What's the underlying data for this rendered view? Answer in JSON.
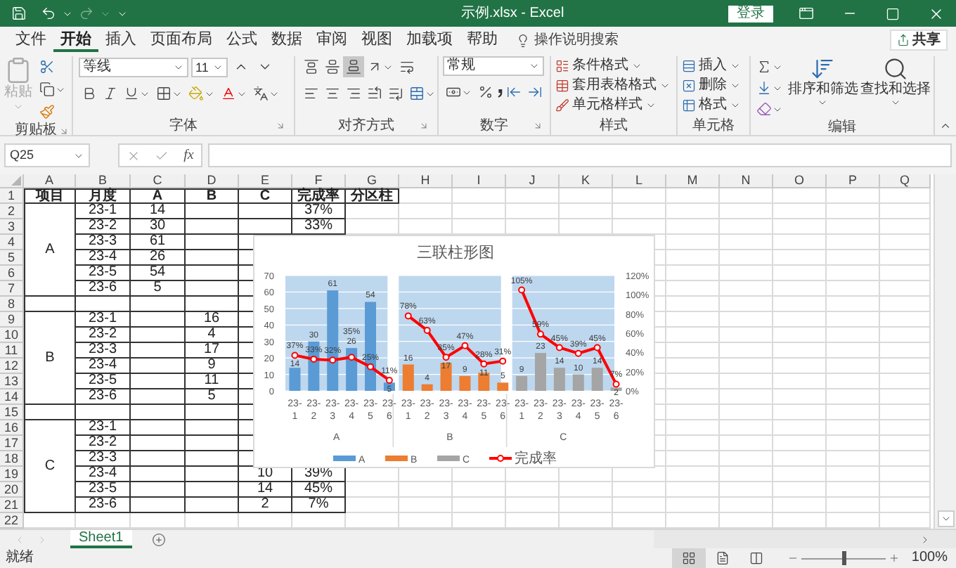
{
  "title_bar": {
    "title": "示例.xlsx - Excel",
    "sign_in": "登录",
    "redo_disabled": true
  },
  "ribbon_tabs": [
    {
      "label": "文件",
      "selected": false
    },
    {
      "label": "开始",
      "selected": true
    },
    {
      "label": "插入",
      "selected": false
    },
    {
      "label": "页面布局",
      "selected": false
    },
    {
      "label": "公式",
      "selected": false
    },
    {
      "label": "数据",
      "selected": false
    },
    {
      "label": "审阅",
      "selected": false
    },
    {
      "label": "视图",
      "selected": false
    },
    {
      "label": "加载项",
      "selected": false
    },
    {
      "label": "帮助",
      "selected": false
    }
  ],
  "tell_me": "操作说明搜索",
  "share": "共享",
  "ribbon": {
    "clipboard": {
      "paste": "粘贴",
      "paste_disabled": true,
      "label": "剪贴板"
    },
    "font": {
      "font_name": "等线",
      "font_size": "11",
      "label": "字体"
    },
    "alignment": {
      "vertical": [
        {
          "kind": "top",
          "selected": false
        },
        {
          "kind": "middle",
          "selected": false
        },
        {
          "kind": "bottom",
          "selected": true
        }
      ],
      "label": "对齐方式"
    },
    "number": {
      "format": "常规",
      "label": "数字"
    },
    "styles": {
      "items": [
        "条件格式",
        "套用表格格式",
        "单元格样式"
      ],
      "label": "样式"
    },
    "cells": {
      "items": [
        "插入",
        "删除",
        "格式"
      ],
      "label": "单元格"
    },
    "editing": {
      "sort": "排序和筛选",
      "find": "查找和选择",
      "label": "编辑"
    }
  },
  "formula_bar": {
    "name_box": "Q25",
    "function_label": "fx"
  },
  "sheet": {
    "columns": [
      "A",
      "B",
      "C",
      "D",
      "E",
      "F",
      "G",
      "H",
      "I",
      "J",
      "K",
      "L",
      "M",
      "N",
      "O",
      "P",
      "Q"
    ],
    "row_numbers": [
      "1",
      "2",
      "3",
      "4",
      "5",
      "6",
      "7",
      "8",
      "9",
      "10",
      "11",
      "12",
      "13",
      "14",
      "15",
      "16",
      "17",
      "18",
      "19",
      "20",
      "21",
      "22"
    ],
    "header_row": [
      "项目",
      "月度",
      "A",
      "B",
      "C",
      "完成率",
      "分区柱"
    ],
    "groups": [
      {
        "item": "A",
        "rows": [
          {
            "month": "23-1",
            "a": "14",
            "rate": "37%"
          },
          {
            "month": "23-2",
            "a": "30",
            "rate": "33%"
          },
          {
            "month": "23-3",
            "a": "61"
          },
          {
            "month": "23-4",
            "a": "26"
          },
          {
            "month": "23-5",
            "a": "54"
          },
          {
            "month": "23-6",
            "a": "5"
          }
        ]
      },
      {
        "item": "B",
        "rows": [
          {
            "month": "23-1",
            "b": "16"
          },
          {
            "month": "23-2",
            "b": "4"
          },
          {
            "month": "23-3",
            "b": "17"
          },
          {
            "month": "23-4",
            "b": "9"
          },
          {
            "month": "23-5",
            "b": "11"
          },
          {
            "month": "23-6",
            "b": "5"
          }
        ]
      },
      {
        "item": "C",
        "rows": [
          {
            "month": "23-1"
          },
          {
            "month": "23-2"
          },
          {
            "month": "23-3"
          },
          {
            "month": "23-4",
            "c": "10",
            "rate": "39%"
          },
          {
            "month": "23-5",
            "c": "14",
            "rate": "45%"
          },
          {
            "month": "23-6",
            "c": "2",
            "rate": "7%"
          }
        ]
      }
    ]
  },
  "chart": {
    "chart_data": {
      "type": "bar",
      "title": "三联柱形图",
      "categories": [
        "23-1",
        "23-2",
        "23-3",
        "23-4",
        "23-5",
        "23-6",
        "23-1",
        "23-2",
        "23-3",
        "23-4",
        "23-5",
        "23-6",
        "23-1",
        "23-2",
        "23-3",
        "23-4",
        "23-5",
        "23-6"
      ],
      "annotations": [
        {
          "text": "A"
        },
        {
          "text": "B"
        },
        {
          "text": "C"
        }
      ],
      "series": [
        {
          "name": "A",
          "color": "#5b9bd5",
          "values": [
            14,
            30,
            61,
            26,
            54,
            5,
            null,
            null,
            null,
            null,
            null,
            null,
            null,
            null,
            null,
            null,
            null,
            null
          ],
          "value_labels": [
            "14",
            "30",
            "61",
            "26",
            "54",
            "5",
            null,
            null,
            null,
            null,
            null,
            null,
            null,
            null,
            null,
            null,
            null,
            null
          ]
        },
        {
          "name": "B",
          "color": "#ed7d31",
          "values": [
            null,
            null,
            null,
            null,
            null,
            null,
            16,
            4,
            17,
            9,
            11,
            5,
            null,
            null,
            null,
            null,
            null,
            null
          ],
          "value_labels": [
            null,
            null,
            null,
            null,
            null,
            null,
            "16",
            "4",
            "17",
            "9",
            "11",
            "5",
            null,
            null,
            null,
            null,
            null,
            null
          ]
        },
        {
          "name": "C",
          "color": "#a5a5a5",
          "values": [
            null,
            null,
            null,
            null,
            null,
            null,
            null,
            null,
            null,
            null,
            null,
            null,
            9,
            23,
            14,
            10,
            14,
            2
          ],
          "value_labels": [
            null,
            null,
            null,
            null,
            null,
            null,
            null,
            null,
            null,
            null,
            null,
            null,
            "9",
            "23",
            "14",
            "10",
            "14",
            "2"
          ]
        },
        {
          "name": "完成率",
          "color": "#ff0000",
          "type": "line",
          "axis": "y2",
          "marker": "circle",
          "values": [
            37,
            33,
            32,
            35,
            25,
            11,
            78,
            63,
            35,
            47,
            28,
            31,
            105,
            59,
            45,
            39,
            45,
            7
          ],
          "value_labels": [
            "37%",
            "33%",
            "32%",
            "35%",
            "25%",
            "11%",
            "78%",
            "63%",
            "35%",
            "47%",
            "28%",
            "31%",
            "105%",
            "59%",
            "45%",
            "39%",
            "45%",
            "7%"
          ]
        }
      ],
      "ylim": [
        0,
        70
      ],
      "yticks": [
        {
          "value": 0,
          "label": "0"
        },
        {
          "value": 10,
          "label": "10"
        },
        {
          "value": 20,
          "label": "20"
        },
        {
          "value": 30,
          "label": "30"
        },
        {
          "value": 40,
          "label": "40"
        },
        {
          "value": 50,
          "label": "50"
        },
        {
          "value": 60,
          "label": "60"
        },
        {
          "value": 70,
          "label": "70"
        }
      ],
      "y2lim": [
        0,
        120
      ],
      "y2ticks": [
        {
          "value": 0,
          "label": "0%"
        },
        {
          "value": 20,
          "label": "20%"
        },
        {
          "value": 40,
          "label": "40%"
        },
        {
          "value": 60,
          "label": "60%"
        },
        {
          "value": 80,
          "label": "80%"
        },
        {
          "value": 100,
          "label": "100%"
        },
        {
          "value": 120,
          "label": "120%"
        }
      ],
      "data_labels": true,
      "grid": true,
      "legend": true
    }
  },
  "sheet_tabs": [
    {
      "label": "Sheet1",
      "selected": true
    }
  ],
  "status_bar": {
    "status": "就绪",
    "views": [
      {
        "kind": "normal",
        "selected": true
      },
      {
        "kind": "page_layout",
        "selected": false
      },
      {
        "kind": "page_break",
        "selected": false
      }
    ],
    "zoom": {
      "level": 0.5,
      "reading": "100%"
    }
  }
}
